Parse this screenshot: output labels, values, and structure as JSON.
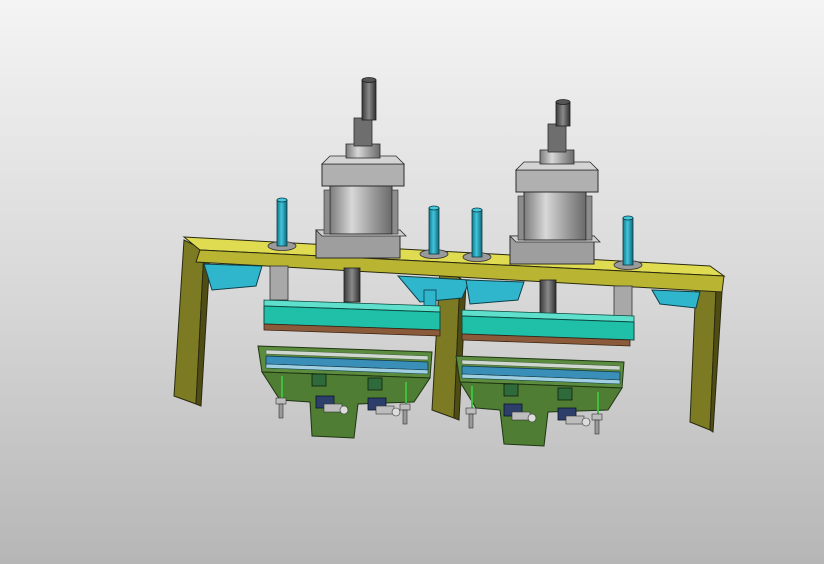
{
  "viewer": {
    "background_top": "#f4f4f4",
    "background_bottom": "#b6b6b6"
  },
  "model": {
    "frame_color": "#c9c43a",
    "frame_dark": "#6f6c1c",
    "platen_color": "#1fbfa8",
    "bracket_color": "#2aa8bf",
    "rod_color": "#22a7bf",
    "cylinder_color": "#b5b5b5",
    "base_color": "#5a8a3c",
    "rail_color": "#3a8fb8",
    "wood_color": "#8a5a3a",
    "stations": [
      {
        "name": "station-left"
      },
      {
        "name": "station-right"
      }
    ]
  }
}
